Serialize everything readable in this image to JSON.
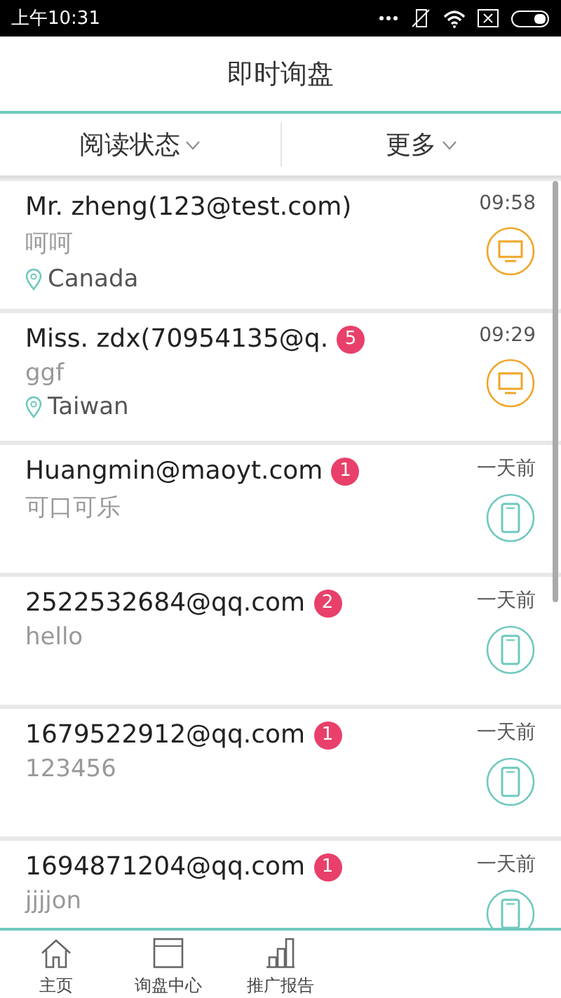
{
  "status_bar": {
    "time": "上午10:31"
  },
  "header": {
    "title": "即时询盘"
  },
  "filters": [
    {
      "label": "阅读状态"
    },
    {
      "label": "更多"
    }
  ],
  "inquiries": [
    {
      "name": "Mr. zheng(123@test.com)",
      "time": "09:58",
      "message": "呵呵",
      "location": "Canada",
      "kind": "desktop"
    },
    {
      "name": "Miss. zdx(70954135@q.",
      "unread": "5",
      "time": "09:29",
      "message": "ggf",
      "location": "Taiwan",
      "kind": "desktop"
    },
    {
      "name": "Huangmin@maoyt.com",
      "unread": "1",
      "time": "一天前",
      "message": "可口可乐",
      "kind": "mobile"
    },
    {
      "name": "2522532684@qq.com",
      "unread": "2",
      "time": "一天前",
      "message": "hello",
      "kind": "mobile"
    },
    {
      "name": "1679522912@qq.com",
      "unread": "1",
      "time": "一天前",
      "message": "123456",
      "kind": "mobile"
    },
    {
      "name": "1694871204@qq.com",
      "unread": "1",
      "time": "一天前",
      "message": "jjjjon",
      "kind": "mobile"
    }
  ],
  "tab_bar": [
    {
      "label": "主页"
    },
    {
      "label": "询盘中心"
    },
    {
      "label": "推广报告"
    }
  ]
}
